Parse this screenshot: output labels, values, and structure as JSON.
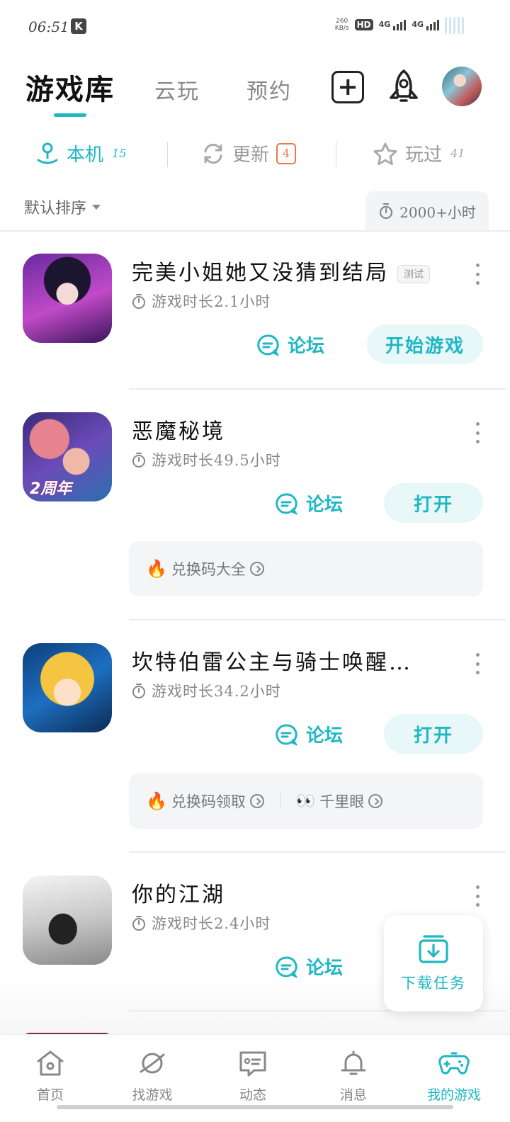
{
  "status_bar": {
    "time": "06:51",
    "app_badge": "K",
    "net_speed": "260",
    "net_unit": "KB/s",
    "hd": "HD",
    "sim1": "4G",
    "sim2": "4G"
  },
  "top_tabs": {
    "library": "游戏库",
    "cloud": "云玩",
    "reserve": "预约"
  },
  "sub_tabs": {
    "local": {
      "label": "本机",
      "count": "15"
    },
    "update": {
      "label": "更新",
      "count": "4"
    },
    "played": {
      "label": "玩过",
      "count": "41"
    }
  },
  "sort": {
    "label": "默认排序",
    "time_filter": "2000+小时"
  },
  "games": [
    {
      "title": "完美小姐她又没猜到结局",
      "tag": "测试",
      "playtime": "游戏时长2.1小时",
      "forum": "论坛",
      "action": "开始游戏"
    },
    {
      "title": "恶魔秘境",
      "icon_badge": "2周年",
      "playtime": "游戏时长49.5小时",
      "forum": "论坛",
      "action": "打开",
      "promo": [
        {
          "icon": "fire-icon",
          "text": "兑换码大全"
        }
      ]
    },
    {
      "title": "坎特伯雷公主与骑士唤醒…",
      "playtime": "游戏时长34.2小时",
      "forum": "论坛",
      "action": "打开",
      "promo": [
        {
          "icon": "fire-icon",
          "text": "兑换码领取"
        },
        {
          "icon": "eyes-icon",
          "text": "千里眼"
        }
      ]
    },
    {
      "title": "你的江湖",
      "playtime": "游戏时长2.4小时",
      "forum": "论坛"
    }
  ],
  "download_task": {
    "label": "下载任务"
  },
  "bottom_nav": [
    {
      "label": "首页",
      "icon": "home-icon"
    },
    {
      "label": "找游戏",
      "icon": "planet-icon"
    },
    {
      "label": "动态",
      "icon": "message-card-icon"
    },
    {
      "label": "消息",
      "icon": "bell-icon"
    },
    {
      "label": "我的游戏",
      "icon": "gamepad-icon",
      "active": true
    }
  ],
  "colors": {
    "accent": "#1fb7c4",
    "badge_orange": "#e87a4a"
  }
}
